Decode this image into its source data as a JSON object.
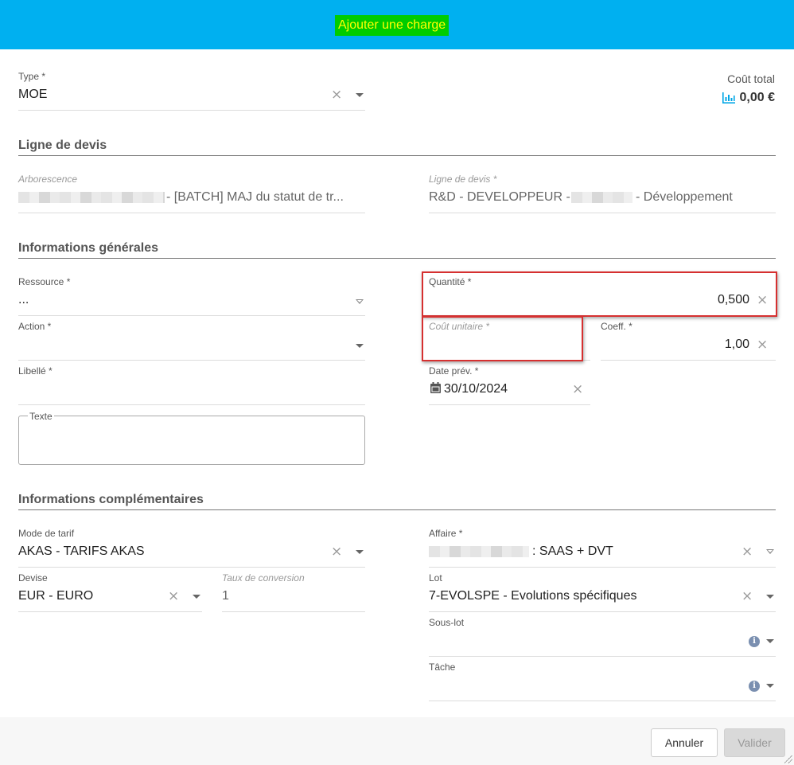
{
  "header": {
    "title": "Ajouter une charge"
  },
  "cost": {
    "label": "Coût total",
    "value": "0,00 €",
    "icon": "bar-chart-icon",
    "icon_color": "#00a6e6"
  },
  "type": {
    "label": "Type *",
    "value": "MOE"
  },
  "sections": {
    "ligne": "Ligne de devis",
    "general": "Informations générales",
    "complementary": "Informations complémentaires"
  },
  "arborescence": {
    "label": "Arborescence",
    "value": "- [BATCH] MAJ du statut de tr..."
  },
  "ligne_devis": {
    "label": "Ligne de devis *",
    "value_prefix": "R&D - DEVELOPPEUR -",
    "value_suffix": "- Développement"
  },
  "ressource": {
    "label": "Ressource *",
    "value": "..."
  },
  "action": {
    "label": "Action *",
    "value": ""
  },
  "libelle": {
    "label": "Libellé *",
    "value": ""
  },
  "texte": {
    "label": "Texte",
    "value": ""
  },
  "quantite": {
    "label": "Quantité *",
    "value": "0,500"
  },
  "cout_unitaire": {
    "label": "Coût unitaire *",
    "value": ""
  },
  "coeff": {
    "label": "Coeff. *",
    "value": "1,00"
  },
  "date_prev": {
    "label": "Date prév. *",
    "value": "30/10/2024"
  },
  "mode_tarif": {
    "label": "Mode de tarif",
    "value": "AKAS - TARIFS AKAS"
  },
  "devise": {
    "label": "Devise",
    "value": "EUR - EURO"
  },
  "taux": {
    "label": "Taux de conversion",
    "value": "1"
  },
  "affaire": {
    "label": "Affaire *",
    "value": ": SAAS + DVT"
  },
  "lot": {
    "label": "Lot",
    "value": "7-EVOLSPE - Evolutions spécifiques"
  },
  "sous_lot": {
    "label": "Sous-lot",
    "value": ""
  },
  "tache": {
    "label": "Tâche",
    "value": ""
  },
  "buttons": {
    "cancel": "Annuler",
    "validate": "Valider"
  },
  "colors": {
    "header": "#00b0f0",
    "title_bg": "#00cc00",
    "title_text": "#ffff00",
    "highlight": "#d63030"
  }
}
